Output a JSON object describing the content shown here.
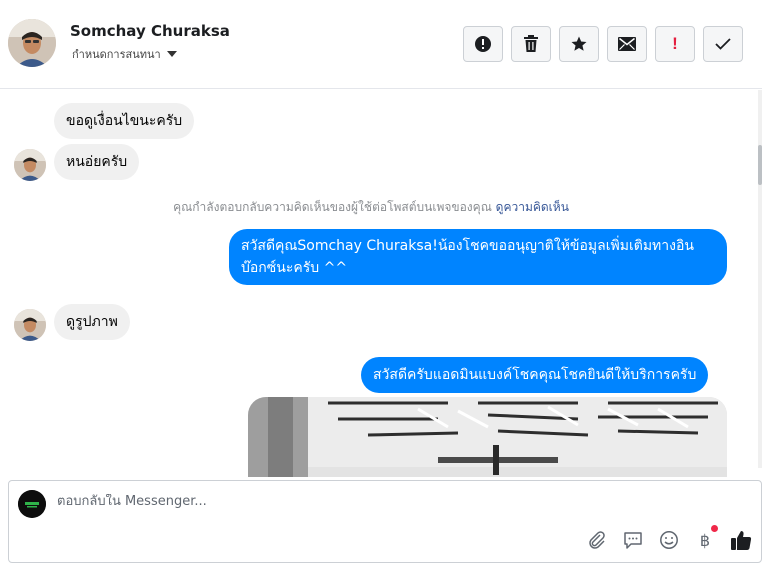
{
  "header": {
    "contact_name": "Somchay Churaksa",
    "assign_label": "กำหนดการสนทนา",
    "actions": [
      {
        "name": "report-button",
        "icon": "exclamation-circle-icon"
      },
      {
        "name": "delete-button",
        "icon": "trash-icon"
      },
      {
        "name": "star-button",
        "icon": "star-icon"
      },
      {
        "name": "mark-unread-button",
        "icon": "envelope-icon"
      },
      {
        "name": "priority-button",
        "icon": "exclamation-icon",
        "label": "!"
      },
      {
        "name": "mark-done-button",
        "icon": "check-icon"
      }
    ]
  },
  "thread": {
    "messages": [
      {
        "direction": "in",
        "text": "ขอดูเงื่อนไขนะครับ"
      },
      {
        "direction": "in",
        "text": "หนอ่ยครับ"
      },
      {
        "direction": "out",
        "text": "สวัสดีคุณSomchay Churaksa!น้องโชคขออนุญาติให้ข้อมูลเพิ่มเติมทางอินบ๊อกซ์นะครับ ^^"
      },
      {
        "direction": "in",
        "text": "ดูรูปภาพ"
      },
      {
        "direction": "out",
        "text": "สวัสดีครับแอดมินแบงค์โชคคุณโชคยินดีให้บริการครับ"
      }
    ],
    "system_note": "คุณกำลังตอบกลับความคิดเห็นของผู้ใช้ต่อโพสต์บนเพจของคุณ",
    "system_link": "ดูความคิดเห็น"
  },
  "composer": {
    "placeholder": "ตอบกลับใน Messenger...",
    "tools": [
      "paperclip-icon",
      "saved-reply-icon",
      "emoji-icon",
      "baht-payment-icon",
      "like-icon"
    ],
    "baht_symbol": "฿"
  },
  "colors": {
    "outgoing_bubble": "#0084ff",
    "incoming_bubble": "#f0f0f0",
    "priority_red": "#e41e3f",
    "notification_dot": "#f02849"
  }
}
